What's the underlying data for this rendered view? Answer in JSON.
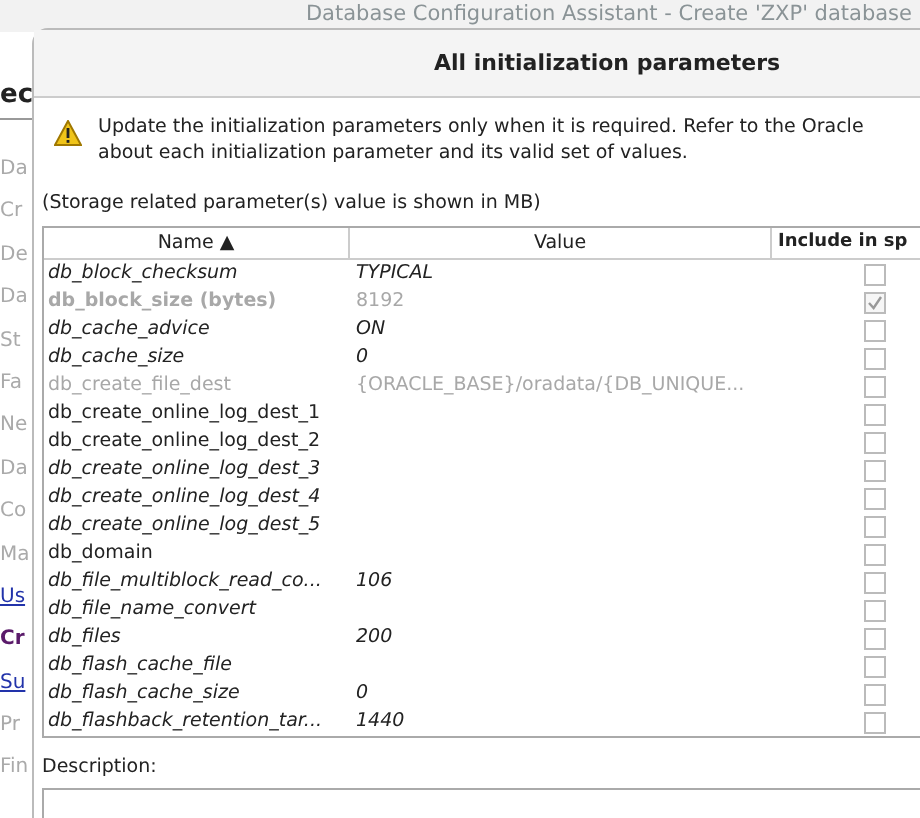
{
  "background_window": {
    "title": "Database Configuration Assistant - Create 'ZXP' database",
    "heading": "ec",
    "steps": [
      {
        "label": "Da",
        "kind": "plain"
      },
      {
        "label": "Cr",
        "kind": "plain"
      },
      {
        "label": "De",
        "kind": "plain"
      },
      {
        "label": "Da",
        "kind": "plain"
      },
      {
        "label": "St",
        "kind": "plain"
      },
      {
        "label": "Fa",
        "kind": "plain"
      },
      {
        "label": "Ne",
        "kind": "plain"
      },
      {
        "label": "Da",
        "kind": "plain"
      },
      {
        "label": "Co",
        "kind": "plain"
      },
      {
        "label": "Ma",
        "kind": "plain"
      },
      {
        "label": "Us",
        "kind": "link"
      },
      {
        "label": "Cr",
        "kind": "current"
      },
      {
        "label": "Su",
        "kind": "link"
      },
      {
        "label": "Pr",
        "kind": "plain"
      },
      {
        "label": "Fin",
        "kind": "plain"
      }
    ]
  },
  "dialog": {
    "title": "All initialization parameters",
    "warning": "Update the initialization parameters only when it is required. Refer to the Oracle about each initialization parameter and its valid set of values.",
    "note": "(Storage related parameter(s) value is shown in MB)",
    "table": {
      "columns": [
        "Name ▲",
        "Value",
        "Include in sp"
      ],
      "rows": [
        {
          "name": "db_block_checksum",
          "value": "TYPICAL",
          "italic": true,
          "disabled": false,
          "include": false
        },
        {
          "name": "db_block_size (bytes)",
          "value": "8192",
          "italic": false,
          "disabled": true,
          "include": true
        },
        {
          "name": "db_cache_advice",
          "value": "ON",
          "italic": true,
          "disabled": false,
          "include": false
        },
        {
          "name": "db_cache_size",
          "value": "0",
          "italic": true,
          "disabled": false,
          "include": false
        },
        {
          "name": "db_create_file_dest",
          "value": "{ORACLE_BASE}/oradata/{DB_UNIQUE...",
          "italic": false,
          "disabled": true,
          "include": false
        },
        {
          "name": "db_create_online_log_dest_1",
          "value": "",
          "italic": false,
          "disabled": false,
          "include": false
        },
        {
          "name": "db_create_online_log_dest_2",
          "value": "",
          "italic": false,
          "disabled": false,
          "include": false
        },
        {
          "name": "db_create_online_log_dest_3",
          "value": "",
          "italic": true,
          "disabled": false,
          "include": false
        },
        {
          "name": "db_create_online_log_dest_4",
          "value": "",
          "italic": true,
          "disabled": false,
          "include": false
        },
        {
          "name": "db_create_online_log_dest_5",
          "value": "",
          "italic": true,
          "disabled": false,
          "include": false
        },
        {
          "name": "db_domain",
          "value": "",
          "italic": false,
          "disabled": false,
          "include": false
        },
        {
          "name": "db_file_multiblock_read_co...",
          "value": "106",
          "italic": true,
          "disabled": false,
          "include": false
        },
        {
          "name": "db_file_name_convert",
          "value": "",
          "italic": true,
          "disabled": false,
          "include": false
        },
        {
          "name": "db_files",
          "value": "200",
          "italic": true,
          "disabled": false,
          "include": false
        },
        {
          "name": "db_flash_cache_file",
          "value": "",
          "italic": true,
          "disabled": false,
          "include": false
        },
        {
          "name": "db_flash_cache_size",
          "value": "0",
          "italic": true,
          "disabled": false,
          "include": false
        },
        {
          "name": "db_flashback_retention_tar...",
          "value": "1440",
          "italic": true,
          "disabled": false,
          "include": false
        }
      ]
    },
    "description_label": "Description:"
  }
}
